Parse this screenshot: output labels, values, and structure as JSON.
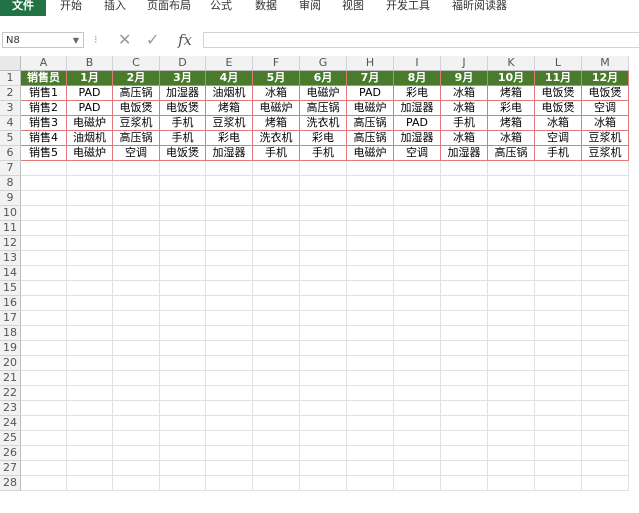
{
  "ribbon": {
    "menu_items": [
      "文件",
      "开始",
      "插入",
      "页面布局",
      "公式",
      "数据",
      "审阅",
      "视图",
      "开发工具",
      "福昕阅读器"
    ]
  },
  "formula_bar": {
    "name_box": "N8",
    "fx_label": "fx",
    "formula": ""
  },
  "sheet": {
    "columns": [
      "A",
      "B",
      "C",
      "D",
      "E",
      "F",
      "G",
      "H",
      "I",
      "J",
      "K",
      "L",
      "M"
    ],
    "row_count": 28,
    "header_row": [
      "销售员",
      "1月",
      "2月",
      "3月",
      "4月",
      "5月",
      "6月",
      "7月",
      "8月",
      "9月",
      "10月",
      "11月",
      "12月"
    ],
    "data_rows": [
      [
        "销售1",
        "PAD",
        "高压锅",
        "加湿器",
        "油烟机",
        "冰箱",
        "电磁炉",
        "PAD",
        "彩电",
        "冰箱",
        "烤箱",
        "电饭煲",
        "电饭煲"
      ],
      [
        "销售2",
        "PAD",
        "电饭煲",
        "电饭煲",
        "烤箱",
        "电磁炉",
        "高压锅",
        "电磁炉",
        "加湿器",
        "冰箱",
        "彩电",
        "电饭煲",
        "空调"
      ],
      [
        "销售3",
        "电磁炉",
        "豆浆机",
        "手机",
        "豆浆机",
        "烤箱",
        "洗衣机",
        "高压锅",
        "PAD",
        "手机",
        "烤箱",
        "冰箱",
        "冰箱"
      ],
      [
        "销售4",
        "油烟机",
        "高压锅",
        "手机",
        "彩电",
        "洗衣机",
        "彩电",
        "高压锅",
        "加湿器",
        "冰箱",
        "冰箱",
        "空调",
        "豆浆机"
      ],
      [
        "销售5",
        "电磁炉",
        "空调",
        "电饭煲",
        "加湿器",
        "手机",
        "手机",
        "电磁炉",
        "空调",
        "加湿器",
        "高压锅",
        "手机",
        "豆浆机"
      ]
    ]
  },
  "colors": {
    "file_tab": "#217346",
    "header_fill": "#4a7a2c",
    "table_border": "#e07a7a"
  }
}
